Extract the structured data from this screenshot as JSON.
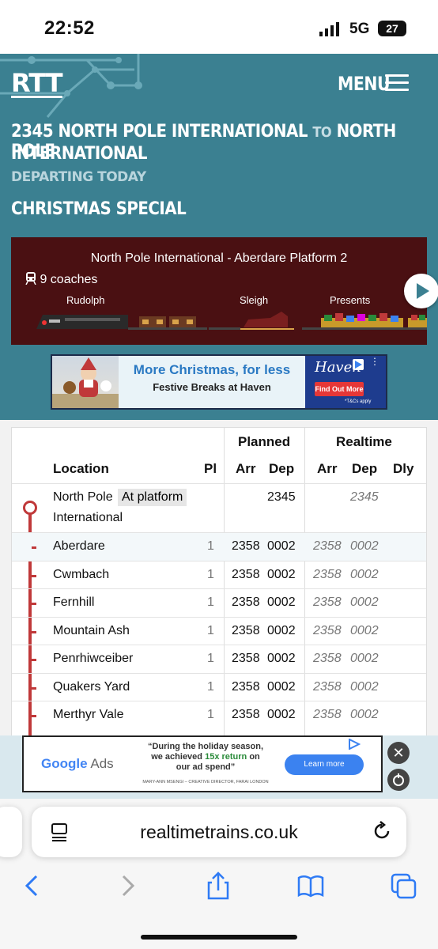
{
  "status_bar": {
    "time": "22:52",
    "network": "5G",
    "battery": "27"
  },
  "header": {
    "logo": "RTT",
    "menu_label": "MENU",
    "service_time": "2345",
    "origin": "NORTH POLE INTERNATIONAL",
    "to_word": "TO",
    "destination_line1": "NORTH POLE",
    "destination_line2": "INTERNATIONAL",
    "departing": "DEPARTING TODAY",
    "service_name": "CHRISTMAS SPECIAL",
    "colors": {
      "header_bg": "#3b8091",
      "train_panel_bg": "#4a1012",
      "route_red": "#c0393a"
    }
  },
  "train_panel": {
    "route": "North Pole International - Aberdare Platform 2",
    "coaches": "9 coaches",
    "vehicles": [
      "Rudolph",
      "Sleigh",
      "Presents"
    ],
    "next_icon": "play-arrow-icon"
  },
  "banner_ad": {
    "headline": "More Christmas, for less",
    "subline": "Festive Breaks at Haven",
    "brand": "Haven",
    "cta": "Find Out More",
    "terms": "*T&Cs apply"
  },
  "table": {
    "group_headers": {
      "planned": "Planned",
      "realtime": "Realtime"
    },
    "columns": {
      "location": "Location",
      "pl": "Pl",
      "arr": "Arr",
      "dep": "Dep",
      "rt_arr": "Arr",
      "rt_dep": "Dep",
      "dly": "Dly"
    },
    "origin": {
      "name_line1": "North Pole",
      "name_line2": "International",
      "badge": "At platform",
      "dep": "2345",
      "rt_dep": "2345"
    },
    "rows": [
      {
        "location": "Aberdare",
        "pl": "1",
        "arr": "2358",
        "dep": "0002",
        "rt_arr": "2358",
        "rt_dep": "0002"
      },
      {
        "location": "Cwmbach",
        "pl": "1",
        "arr": "2358",
        "dep": "0002",
        "rt_arr": "2358",
        "rt_dep": "0002"
      },
      {
        "location": "Fernhill",
        "pl": "1",
        "arr": "2358",
        "dep": "0002",
        "rt_arr": "2358",
        "rt_dep": "0002"
      },
      {
        "location": "Mountain Ash",
        "pl": "1",
        "arr": "2358",
        "dep": "0002",
        "rt_arr": "2358",
        "rt_dep": "0002"
      },
      {
        "location": "Penrhiwceiber",
        "pl": "1",
        "arr": "2358",
        "dep": "0002",
        "rt_arr": "2358",
        "rt_dep": "0002"
      },
      {
        "location": "Quakers Yard",
        "pl": "1",
        "arr": "2358",
        "dep": "0002",
        "rt_arr": "2358",
        "rt_dep": "0002"
      },
      {
        "location": "Merthyr Vale",
        "pl": "1",
        "arr": "2358",
        "dep": "0002",
        "rt_arr": "2358",
        "rt_dep": "0002"
      }
    ]
  },
  "google_ad": {
    "logo_google": "Google",
    "logo_ads": "Ads",
    "quote_a": "“During the holiday season,",
    "quote_b": "we achieved ",
    "quote_highlight": "15x return",
    "quote_c": " on",
    "quote_d": "our ad spend”",
    "attribution": "MARY-ANN MSENGI – CREATIVE DIRECTOR, FARAI LONDON",
    "cta": "Learn more"
  },
  "browser": {
    "url": "realtimetrains.co.uk"
  }
}
